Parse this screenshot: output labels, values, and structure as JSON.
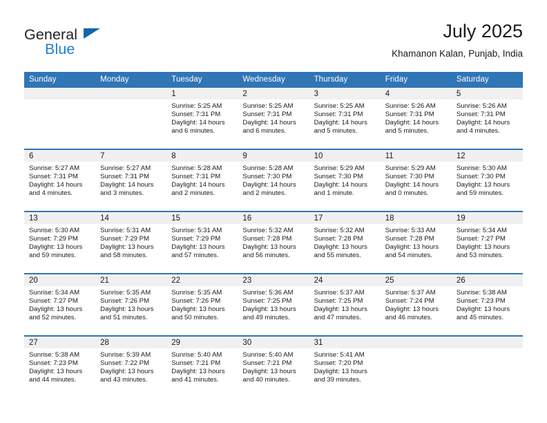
{
  "brand": {
    "name_top": "General",
    "name_bottom": "Blue",
    "accent_color": "#1b7fd4",
    "triangle_color": "#1266ae"
  },
  "header": {
    "title": "July 2025",
    "location": "Khamanon Kalan, Punjab, India"
  },
  "colors": {
    "header_blue": "#3075b6",
    "daynum_band": "#f0f0f0",
    "text": "#1a1a1a"
  },
  "weekday_headers": [
    "Sunday",
    "Monday",
    "Tuesday",
    "Wednesday",
    "Thursday",
    "Friday",
    "Saturday"
  ],
  "weeks": [
    [
      {
        "day": "",
        "sunrise": "",
        "sunset": "",
        "daylight": "",
        "empty": true
      },
      {
        "day": "",
        "sunrise": "",
        "sunset": "",
        "daylight": "",
        "empty": true
      },
      {
        "day": "1",
        "sunrise": "Sunrise: 5:25 AM",
        "sunset": "Sunset: 7:31 PM",
        "daylight": "Daylight: 14 hours and 6 minutes."
      },
      {
        "day": "2",
        "sunrise": "Sunrise: 5:25 AM",
        "sunset": "Sunset: 7:31 PM",
        "daylight": "Daylight: 14 hours and 6 minutes."
      },
      {
        "day": "3",
        "sunrise": "Sunrise: 5:25 AM",
        "sunset": "Sunset: 7:31 PM",
        "daylight": "Daylight: 14 hours and 5 minutes."
      },
      {
        "day": "4",
        "sunrise": "Sunrise: 5:26 AM",
        "sunset": "Sunset: 7:31 PM",
        "daylight": "Daylight: 14 hours and 5 minutes."
      },
      {
        "day": "5",
        "sunrise": "Sunrise: 5:26 AM",
        "sunset": "Sunset: 7:31 PM",
        "daylight": "Daylight: 14 hours and 4 minutes."
      }
    ],
    [
      {
        "day": "6",
        "sunrise": "Sunrise: 5:27 AM",
        "sunset": "Sunset: 7:31 PM",
        "daylight": "Daylight: 14 hours and 4 minutes."
      },
      {
        "day": "7",
        "sunrise": "Sunrise: 5:27 AM",
        "sunset": "Sunset: 7:31 PM",
        "daylight": "Daylight: 14 hours and 3 minutes."
      },
      {
        "day": "8",
        "sunrise": "Sunrise: 5:28 AM",
        "sunset": "Sunset: 7:31 PM",
        "daylight": "Daylight: 14 hours and 2 minutes."
      },
      {
        "day": "9",
        "sunrise": "Sunrise: 5:28 AM",
        "sunset": "Sunset: 7:30 PM",
        "daylight": "Daylight: 14 hours and 2 minutes."
      },
      {
        "day": "10",
        "sunrise": "Sunrise: 5:29 AM",
        "sunset": "Sunset: 7:30 PM",
        "daylight": "Daylight: 14 hours and 1 minute."
      },
      {
        "day": "11",
        "sunrise": "Sunrise: 5:29 AM",
        "sunset": "Sunset: 7:30 PM",
        "daylight": "Daylight: 14 hours and 0 minutes."
      },
      {
        "day": "12",
        "sunrise": "Sunrise: 5:30 AM",
        "sunset": "Sunset: 7:30 PM",
        "daylight": "Daylight: 13 hours and 59 minutes."
      }
    ],
    [
      {
        "day": "13",
        "sunrise": "Sunrise: 5:30 AM",
        "sunset": "Sunset: 7:29 PM",
        "daylight": "Daylight: 13 hours and 59 minutes."
      },
      {
        "day": "14",
        "sunrise": "Sunrise: 5:31 AM",
        "sunset": "Sunset: 7:29 PM",
        "daylight": "Daylight: 13 hours and 58 minutes."
      },
      {
        "day": "15",
        "sunrise": "Sunrise: 5:31 AM",
        "sunset": "Sunset: 7:29 PM",
        "daylight": "Daylight: 13 hours and 57 minutes."
      },
      {
        "day": "16",
        "sunrise": "Sunrise: 5:32 AM",
        "sunset": "Sunset: 7:28 PM",
        "daylight": "Daylight: 13 hours and 56 minutes."
      },
      {
        "day": "17",
        "sunrise": "Sunrise: 5:32 AM",
        "sunset": "Sunset: 7:28 PM",
        "daylight": "Daylight: 13 hours and 55 minutes."
      },
      {
        "day": "18",
        "sunrise": "Sunrise: 5:33 AM",
        "sunset": "Sunset: 7:28 PM",
        "daylight": "Daylight: 13 hours and 54 minutes."
      },
      {
        "day": "19",
        "sunrise": "Sunrise: 5:34 AM",
        "sunset": "Sunset: 7:27 PM",
        "daylight": "Daylight: 13 hours and 53 minutes."
      }
    ],
    [
      {
        "day": "20",
        "sunrise": "Sunrise: 5:34 AM",
        "sunset": "Sunset: 7:27 PM",
        "daylight": "Daylight: 13 hours and 52 minutes."
      },
      {
        "day": "21",
        "sunrise": "Sunrise: 5:35 AM",
        "sunset": "Sunset: 7:26 PM",
        "daylight": "Daylight: 13 hours and 51 minutes."
      },
      {
        "day": "22",
        "sunrise": "Sunrise: 5:35 AM",
        "sunset": "Sunset: 7:26 PM",
        "daylight": "Daylight: 13 hours and 50 minutes."
      },
      {
        "day": "23",
        "sunrise": "Sunrise: 5:36 AM",
        "sunset": "Sunset: 7:25 PM",
        "daylight": "Daylight: 13 hours and 49 minutes."
      },
      {
        "day": "24",
        "sunrise": "Sunrise: 5:37 AM",
        "sunset": "Sunset: 7:25 PM",
        "daylight": "Daylight: 13 hours and 47 minutes."
      },
      {
        "day": "25",
        "sunrise": "Sunrise: 5:37 AM",
        "sunset": "Sunset: 7:24 PM",
        "daylight": "Daylight: 13 hours and 46 minutes."
      },
      {
        "day": "26",
        "sunrise": "Sunrise: 5:38 AM",
        "sunset": "Sunset: 7:23 PM",
        "daylight": "Daylight: 13 hours and 45 minutes."
      }
    ],
    [
      {
        "day": "27",
        "sunrise": "Sunrise: 5:38 AM",
        "sunset": "Sunset: 7:23 PM",
        "daylight": "Daylight: 13 hours and 44 minutes."
      },
      {
        "day": "28",
        "sunrise": "Sunrise: 5:39 AM",
        "sunset": "Sunset: 7:22 PM",
        "daylight": "Daylight: 13 hours and 43 minutes."
      },
      {
        "day": "29",
        "sunrise": "Sunrise: 5:40 AM",
        "sunset": "Sunset: 7:21 PM",
        "daylight": "Daylight: 13 hours and 41 minutes."
      },
      {
        "day": "30",
        "sunrise": "Sunrise: 5:40 AM",
        "sunset": "Sunset: 7:21 PM",
        "daylight": "Daylight: 13 hours and 40 minutes."
      },
      {
        "day": "31",
        "sunrise": "Sunrise: 5:41 AM",
        "sunset": "Sunset: 7:20 PM",
        "daylight": "Daylight: 13 hours and 39 minutes."
      },
      {
        "day": "",
        "sunrise": "",
        "sunset": "",
        "daylight": "",
        "empty": true
      },
      {
        "day": "",
        "sunrise": "",
        "sunset": "",
        "daylight": "",
        "empty": true
      }
    ]
  ]
}
